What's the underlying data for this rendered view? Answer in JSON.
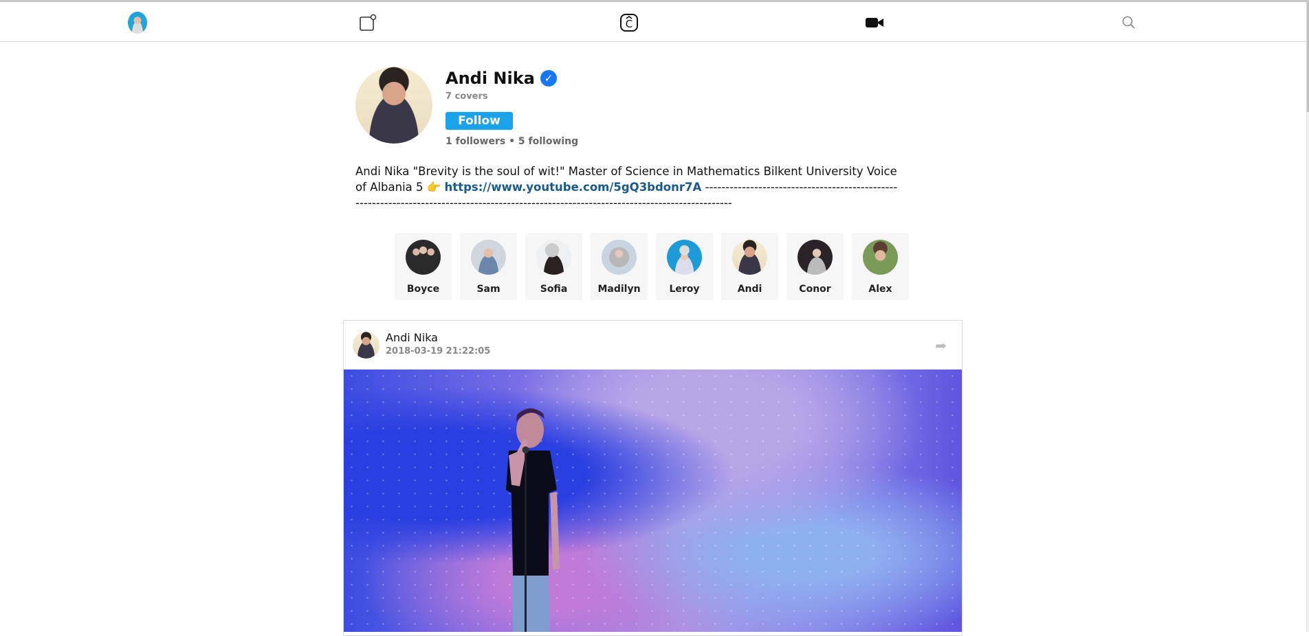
{
  "nav": {
    "items": [
      {
        "icon": "user-avatar-icon"
      },
      {
        "icon": "new-post-icon"
      },
      {
        "icon": "covers-logo-icon"
      },
      {
        "icon": "video-camera-icon"
      },
      {
        "icon": "search-icon"
      }
    ]
  },
  "profile": {
    "name": "Andi Nika",
    "verified_icon": "verified-badge-icon",
    "covers": "7 covers",
    "follow_label": "Follow",
    "stats": "1 followers • 5 following",
    "bio_text": "Andi Nika \"Brevity is the soul of wit!\" Master of Science in Mathematics Bilkent University Voice of Albania 5 ",
    "bio_emoji": "👉",
    "bio_link": "https://www.youtube.com/5gQ3bdonr7A",
    "bio_tail": " -------------------------------------------------------------------------------------------------------------------------------------------",
    "accent": "#1aa3e8"
  },
  "friends": [
    {
      "name": "Boyce"
    },
    {
      "name": "Sam"
    },
    {
      "name": "Sofia"
    },
    {
      "name": "Madilyn"
    },
    {
      "name": "Leroy"
    },
    {
      "name": "Andi"
    },
    {
      "name": "Conor"
    },
    {
      "name": "Alex"
    }
  ],
  "post": {
    "author": "Andi Nika",
    "date": "2018-03-19 21:22:05",
    "share_icon": "share-icon"
  }
}
